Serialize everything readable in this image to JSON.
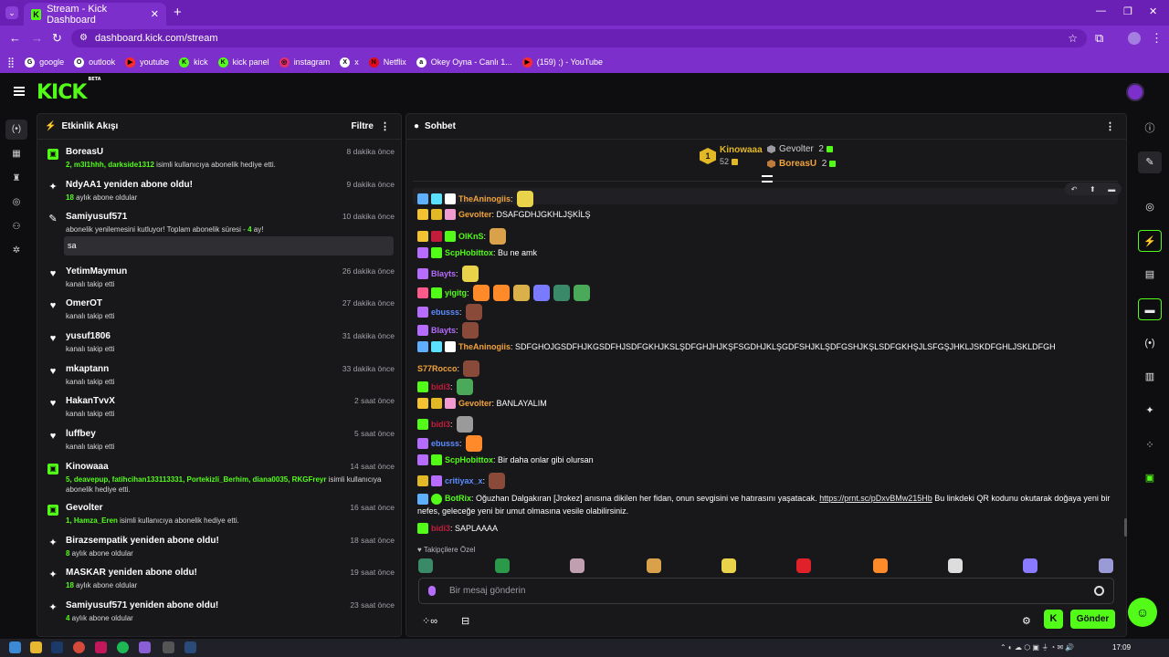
{
  "browser": {
    "tab_title": "Stream - Kick Dashboard",
    "tab_favicon": "K",
    "tab_close": "✕",
    "new_tab": "+",
    "url": "dashboard.kick.com/stream",
    "bookmarks": [
      {
        "label": "google",
        "color": "#ffffff",
        "glyph": "G"
      },
      {
        "label": "outlook",
        "color": "#ffffff",
        "glyph": "O"
      },
      {
        "label": "youtube",
        "color": "#ff2a2a",
        "glyph": "▶"
      },
      {
        "label": "kick",
        "color": "#53fc18",
        "glyph": "K"
      },
      {
        "label": "kick panel",
        "color": "#53fc18",
        "glyph": "K"
      },
      {
        "label": "instagram",
        "color": "#e1306c",
        "glyph": "◎"
      },
      {
        "label": "x",
        "color": "#ffffff",
        "glyph": "X"
      },
      {
        "label": "Netflix",
        "color": "#e50914",
        "glyph": "N"
      },
      {
        "label": "Okey Oyna - Canlı 1...",
        "color": "#ffffff",
        "glyph": "a"
      },
      {
        "label": "(159) ;) - YouTube",
        "color": "#ff2a2a",
        "glyph": "▶"
      }
    ]
  },
  "header": {
    "logo": "KICK",
    "logo_tag": "BETA"
  },
  "activity": {
    "title": "Etkinlik Akışı",
    "filter_label": "Filtre",
    "events": [
      {
        "icon": "gift",
        "name": "BoreasU",
        "time": "8 dakika önce",
        "sub_highlight": "2, m3l1hhh, darkside1312",
        "sub": " isimli kullanıcıya abonelik hediye etti."
      },
      {
        "icon": "sparkle",
        "name": "NdyAA1 yeniden abone oldu!",
        "time": "9 dakika önce",
        "sub_highlight": "18",
        "sub": " aylık abone oldular"
      },
      {
        "icon": "party",
        "name": "Samiyusuf571",
        "time": "10 dakika önce",
        "sub_prefix": "abonelik yenilemesini kutluyor! Toplam abonelik süresi - ",
        "sub_highlight": "4",
        "sub": " ay!",
        "message": "sa"
      },
      {
        "icon": "heart",
        "name": "YetimMaymun",
        "time": "26 dakika önce",
        "sub": "kanalı takip etti"
      },
      {
        "icon": "heart",
        "name": "OmerOT",
        "time": "27 dakika önce",
        "sub": "kanalı takip etti"
      },
      {
        "icon": "heart",
        "name": "yusuf1806",
        "time": "31 dakika önce",
        "sub": "kanalı takip etti"
      },
      {
        "icon": "heart",
        "name": "mkaptann",
        "time": "33 dakika önce",
        "sub": "kanalı takip etti"
      },
      {
        "icon": "heart",
        "name": "HakanTvvX",
        "time": "2 saat önce",
        "sub": "kanalı takip etti"
      },
      {
        "icon": "heart",
        "name": "luffbey",
        "time": "5 saat önce",
        "sub": "kanalı takip etti"
      },
      {
        "icon": "gift",
        "name": "Kinowaaa",
        "time": "14 saat önce",
        "sub_highlight": "5, deavepup, fatihcihan133113331, Portekizli_Berhim, diana0035, RKGFreyr",
        "sub": " isimli kullanıcıya abonelik hediye etti."
      },
      {
        "icon": "gift",
        "name": "Gevolter",
        "time": "16 saat önce",
        "sub_highlight": "1, Hamza_Eren",
        "sub": " isimli kullanıcıya abonelik hediye etti."
      },
      {
        "icon": "sparkle",
        "name": "Birazsempatik yeniden abone oldu!",
        "time": "18 saat önce",
        "sub_highlight": "8",
        "sub": " aylık abone oldular"
      },
      {
        "icon": "sparkle",
        "name": "MASKAR yeniden abone oldu!",
        "time": "19 saat önce",
        "sub_highlight": "18",
        "sub": " aylık abone oldular"
      },
      {
        "icon": "sparkle",
        "name": "Samiyusuf571 yeniden abone oldu!",
        "time": "23 saat önce",
        "sub_highlight": "4",
        "sub": " aylık abone oldular"
      }
    ]
  },
  "chat": {
    "title": "Sohbet",
    "leaderboard": {
      "first": {
        "rank": "1",
        "name": "Kinowaaa",
        "count": "52"
      },
      "second": {
        "name": "Gevolter",
        "count": "2"
      },
      "third": {
        "name": "BoreasU",
        "count": "2"
      }
    },
    "messages": [
      {
        "user": "TheAninogiis",
        "color": "#f2a33a",
        "text": "",
        "badges": [
          "#5eb0ff",
          "#5ce0ff",
          "#ffffff"
        ],
        "emotes": [
          "#e8d34a"
        ]
      },
      {
        "user": "Gevolter",
        "color": "#f2a33a",
        "text": "DSAFGDHJGKHLJŞKİLŞ",
        "badges": [
          "#f2c230",
          "#e3b826",
          "#f29bd0"
        ],
        "emotes": []
      },
      {
        "user": "OlKnS",
        "color": "#53fc18",
        "text": "",
        "badges": [
          "#f2c230",
          "#c21d3b",
          "#53fc18"
        ],
        "emotes": [
          "#d9a24a"
        ]
      },
      {
        "user": "ScpHobittox",
        "color": "#53fc18",
        "text": "Bu ne amk",
        "badges": [
          "#b66cff",
          "#53fc18"
        ],
        "emotes": []
      },
      {
        "user": "Blayts",
        "color": "#b66cff",
        "text": "",
        "badges": [
          "#b66cff"
        ],
        "emotes": [
          "#e8d34a"
        ]
      },
      {
        "user": "yigitg",
        "color": "#53fc18",
        "text": "",
        "badges": [
          "#ff5a8a",
          "#53fc18"
        ],
        "emotes": [
          "#ff8a2a",
          "#ff8a2a",
          "#d9b04a",
          "#7a7aff",
          "#3a8a6a",
          "#4aaa5a"
        ]
      },
      {
        "user": "ebusss",
        "color": "#5b8cff",
        "text": "",
        "badges": [
          "#b66cff"
        ],
        "emotes": [
          "#8a4a3a"
        ]
      },
      {
        "user": "Blayts",
        "color": "#b66cff",
        "text": "",
        "badges": [
          "#b66cff"
        ],
        "emotes": [
          "#8a4a3a"
        ]
      },
      {
        "user": "TheAninogiis",
        "color": "#f2a33a",
        "text": "SDFGHOJGSDFHJKGSDFHJSDFGKHJKSLŞDFGHJHJKŞFSGDHJKLŞGDFSHJKLŞDFGSHJKŞLSDFGKHŞJLSFGŞJHKLJSKDFGHLJSKLDFGH",
        "badges": [
          "#5eb0ff",
          "#5ce0ff",
          "#ffffff"
        ],
        "emotes": []
      },
      {
        "user": "S77Rocco",
        "color": "#f2a33a",
        "text": "",
        "badges": [],
        "emotes": [
          "#8a4a3a"
        ]
      },
      {
        "user": "bidi3",
        "color": "#c21d3b",
        "text": "",
        "badges": [
          "#53fc18"
        ],
        "emotes": [
          "#4aaa5a"
        ]
      },
      {
        "user": "Gevolter",
        "color": "#f2a33a",
        "text": "BANLAYALIM",
        "badges": [
          "#f2c230",
          "#e3b826",
          "#f29bd0"
        ],
        "emotes": []
      },
      {
        "user": "bidi3",
        "color": "#c21d3b",
        "text": "",
        "badges": [
          "#53fc18"
        ],
        "emotes": [
          "#9a9a9a"
        ]
      },
      {
        "user": "ebusss",
        "color": "#5b8cff",
        "text": "",
        "badges": [
          "#b66cff"
        ],
        "emotes": [
          "#ff8a2a"
        ]
      },
      {
        "user": "ScpHobittox",
        "color": "#53fc18",
        "text": "Bir daha onlar gibi olursan",
        "badges": [
          "#b66cff",
          "#53fc18"
        ],
        "emotes": []
      },
      {
        "user": "critiyax_x",
        "color": "#5b8cff",
        "text": "",
        "badges": [
          "#e3b826",
          "#b66cff"
        ],
        "emotes": [
          "#8a4a3a"
        ]
      }
    ],
    "botrix": {
      "user": "BotRix",
      "color": "#53fc18",
      "text_before": "Oğuzhan Dalgakıran [Jrokez] anısına dikilen her fidan, onun sevgisini ve hatırasını yaşatacak. ",
      "link": "https://prnt.sc/pDxvBMw215Hb",
      "text_after": " Bu linkdeki QR kodunu okutarak doğaya yeni bir nefes, geleceğe yeni bir umut olmasına vesile olabilirsiniz."
    },
    "last": {
      "user": "bidi3",
      "color": "#c21d3b",
      "text": "SAPLAAAA"
    },
    "followers_only": "Takipçilere Özel",
    "input_placeholder": "Bir mesaj gönderin",
    "send_label": "Gönder"
  },
  "taskbar": {
    "clock": "17:09"
  }
}
